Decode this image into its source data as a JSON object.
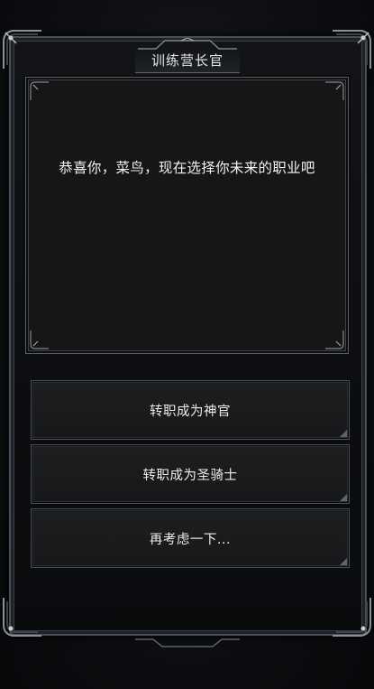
{
  "window": {
    "title": "训练营长官"
  },
  "dialog": {
    "message": "恭喜你，菜鸟，现在选择你未来的职业吧"
  },
  "choices": [
    {
      "label": "转职成为神官"
    },
    {
      "label": "转职成为圣骑士"
    },
    {
      "label": "再考虑一下..."
    }
  ],
  "colors": {
    "frame": "#4a4f57",
    "panel": "#161616",
    "text": "#f2f2f2"
  }
}
